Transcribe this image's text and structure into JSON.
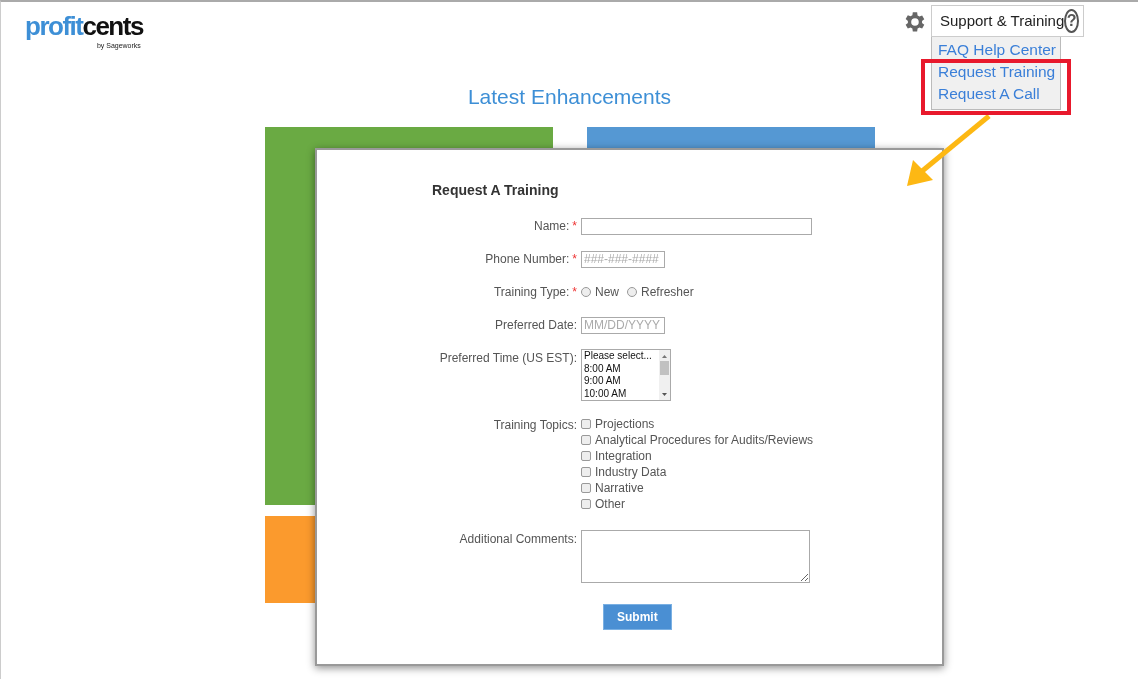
{
  "logo": {
    "word_1": "profit",
    "word_2": "cents",
    "tagline": "by Sageworks"
  },
  "header": {
    "menu_label": "Support & Training",
    "help_glyph": "?",
    "menu_items": [
      {
        "label": "FAQ Help Center",
        "highlighted": false
      },
      {
        "label": "Request Training",
        "highlighted": true
      },
      {
        "label": "Request A Call",
        "highlighted": true
      }
    ]
  },
  "page_title": "Latest Enhancements",
  "tiles": [
    {
      "color": "#6aaa43"
    },
    {
      "color": "#5598d3"
    },
    {
      "color": "#fb9a2d"
    }
  ],
  "form": {
    "title": "Request A Training",
    "fields": [
      {
        "kind": "text",
        "label": "Name:",
        "required_mark": "*"
      },
      {
        "kind": "short",
        "label": "Phone Number:",
        "required_mark": "*",
        "placeholder": "###-###-####"
      },
      {
        "kind": "radio",
        "label": "Training Type:",
        "required_mark": "*",
        "options": [
          {
            "label": "New",
            "selected": false
          },
          {
            "label": "Refresher",
            "selected": false
          }
        ]
      },
      {
        "kind": "short",
        "label": "Preferred Date:",
        "placeholder": "MM/DD/YYYY"
      },
      {
        "kind": "listbox",
        "label": "Preferred Time (US EST):",
        "options": [
          {
            "label": "Please select...",
            "selected": false
          },
          {
            "label": "8:00 AM",
            "selected": false
          },
          {
            "label": "9:00 AM",
            "selected": false
          },
          {
            "label": "10:00 AM",
            "selected": false
          }
        ]
      },
      {
        "kind": "checkbox",
        "label": "Training Topics:",
        "options": [
          {
            "label": "Projections",
            "checked": false
          },
          {
            "label": "Analytical Procedures for Audits/Reviews",
            "checked": false
          },
          {
            "label": "Integration",
            "checked": false
          },
          {
            "label": "Industry Data",
            "checked": false
          },
          {
            "label": "Narrative",
            "checked": false
          },
          {
            "label": "Other",
            "checked": false
          }
        ]
      },
      {
        "kind": "textarea",
        "label": "Additional Comments:"
      }
    ],
    "submit": "Submit"
  }
}
